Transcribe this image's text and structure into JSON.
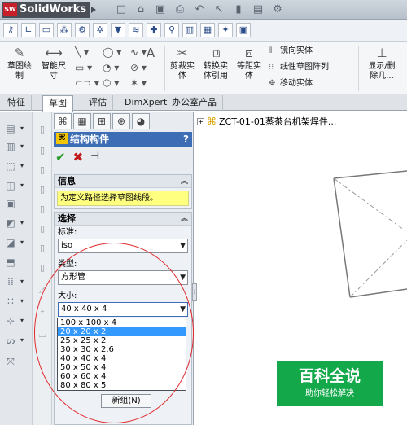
{
  "app": {
    "logo_text": "SolidWorks",
    "logo_badge": "SW"
  },
  "ribbon": {
    "sketch": "草图绘制",
    "smart_dimension": "智能尺寸",
    "trim": "剪裁实体",
    "convert": "转换实体引用",
    "offset": "等距实体",
    "mirror": "镜向实体",
    "linear_pattern": "线性草图阵列",
    "move": "移动实体",
    "show_relations": "显示/删除几..."
  },
  "tabs": [
    "特征",
    "草图",
    "评估",
    "DimXpert",
    "办公室产品"
  ],
  "active_tab_index": 1,
  "feature_tree": {
    "root": "ZCT-01-01蒸茶台机架焊件..."
  },
  "property_manager": {
    "title": "结构构件",
    "help": "?",
    "info_title": "信息",
    "info_text": "为定义路径选择草图线段。",
    "select_title": "选择",
    "standard_label": "标准:",
    "standard_value": "iso",
    "type_label": "类型:",
    "type_value": "方形管",
    "size_label": "大小:",
    "size_value": "40 x 40 x 4",
    "size_options": [
      "100 x 100 x 4",
      "20 x 20 x 2",
      "25 x 25 x 2",
      "30 x 30 x 2.6",
      "40 x 40 x 4",
      "50 x 50 x 4",
      "60 x 60 x 4",
      "80 x 80 x 5"
    ],
    "selected_option_index": 1,
    "new_group": "新组(N)"
  },
  "watermark": {
    "title": "百科全说",
    "subtitle": "助你轻松解决"
  }
}
